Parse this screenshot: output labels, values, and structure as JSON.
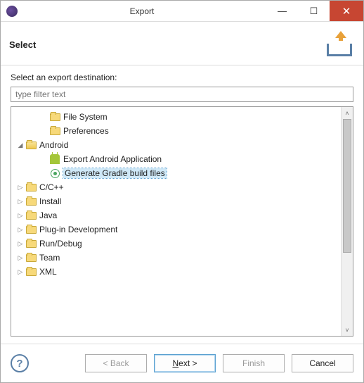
{
  "window": {
    "title": "Export"
  },
  "header": {
    "title": "Select"
  },
  "prompt": "Select an export destination:",
  "filter": {
    "placeholder": "type filter text"
  },
  "tree": {
    "file_system": "File System",
    "preferences": "Preferences",
    "android": "Android",
    "export_app": "Export Android Application",
    "gradle": "Generate Gradle build files",
    "ccpp": "C/C++",
    "install": "Install",
    "java": "Java",
    "plugin": "Plug-in Development",
    "rundebug": "Run/Debug",
    "team": "Team",
    "xml": "XML"
  },
  "buttons": {
    "back": "< Back",
    "next_pre": "N",
    "next_post": "ext >",
    "finish": "Finish",
    "cancel": "Cancel"
  }
}
